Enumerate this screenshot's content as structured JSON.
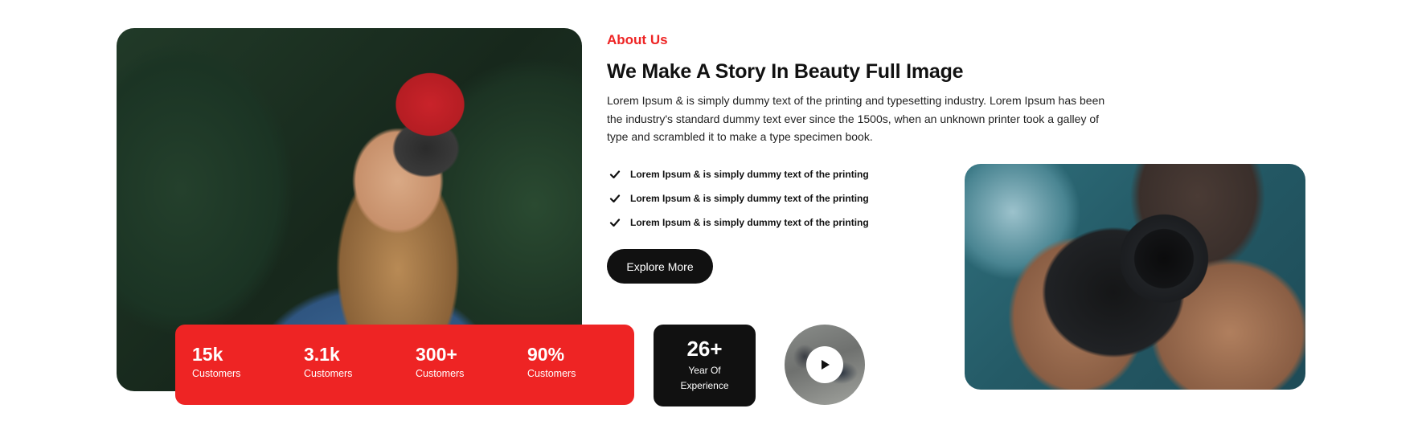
{
  "about": {
    "eyebrow": "About Us",
    "title": "We Make A Story In Beauty Full Image",
    "description": "Lorem Ipsum & is simply dummy text of the printing and typesetting industry. Lorem Ipsum has been the industry's standard dummy text ever since the 1500s, when an unknown printer took a galley of type and scrambled it to make a type specimen book.",
    "checklist": [
      "Lorem Ipsum & is simply dummy text of the printing",
      "Lorem Ipsum & is simply dummy text of the printing",
      "Lorem Ipsum & is simply dummy text of the printing"
    ],
    "check_icon": "checkmark-icon",
    "cta_label": "Explore More"
  },
  "stats": [
    {
      "value": "15k",
      "label": "Customers"
    },
    {
      "value": "3.1k",
      "label": "Customers"
    },
    {
      "value": "300+",
      "label": "Customers"
    },
    {
      "value": "90%",
      "label": "Customers"
    }
  ],
  "experience": {
    "value": "26+",
    "label_line1": "Year Of",
    "label_line2": "Experience"
  },
  "video": {
    "icon": "play-icon"
  },
  "colors": {
    "accent": "#ee2424",
    "dark": "#111111",
    "text": "#222222",
    "background": "#ffffff"
  }
}
